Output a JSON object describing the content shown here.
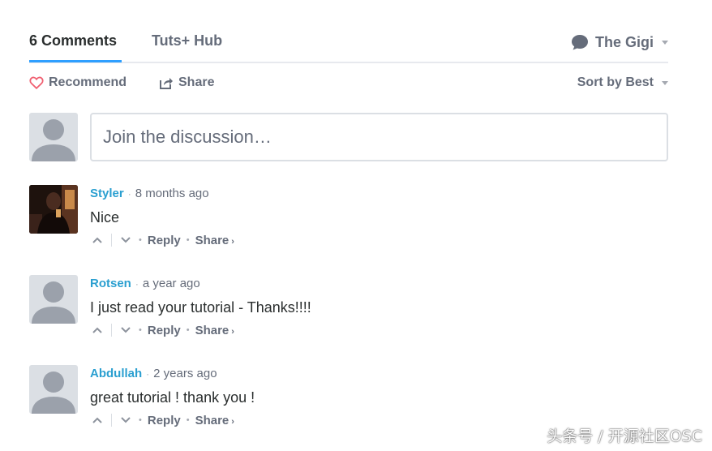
{
  "tabs": {
    "comments": "6 Comments",
    "hub": "Tuts+ Hub"
  },
  "user": {
    "name": "The Gigi"
  },
  "actions": {
    "recommend": "Recommend",
    "share": "Share",
    "sort": "Sort by Best"
  },
  "composer": {
    "placeholder": "Join the discussion…"
  },
  "comments": [
    {
      "author": "Styler",
      "time": "8 months ago",
      "text": "Nice",
      "reply": "Reply",
      "share": "Share"
    },
    {
      "author": "Rotsen",
      "time": "a year ago",
      "text": "I just read your tutorial - Thanks!!!!",
      "reply": "Reply",
      "share": "Share"
    },
    {
      "author": "Abdullah",
      "time": "2 years ago",
      "text": "great tutorial ! thank you !",
      "reply": "Reply",
      "share": "Share"
    }
  ],
  "watermark": "头条号 / 开源社区OSC",
  "colors": {
    "accent": "#2e9fff",
    "author": "#2a9fd0",
    "muted": "#656c7a",
    "heart": "#f05f70"
  },
  "icons": {
    "recommend": "heart-icon",
    "share": "share-arrow-icon",
    "user": "speech-bubble-icon",
    "upvote": "chevron-up-icon",
    "downvote": "chevron-down-icon"
  }
}
